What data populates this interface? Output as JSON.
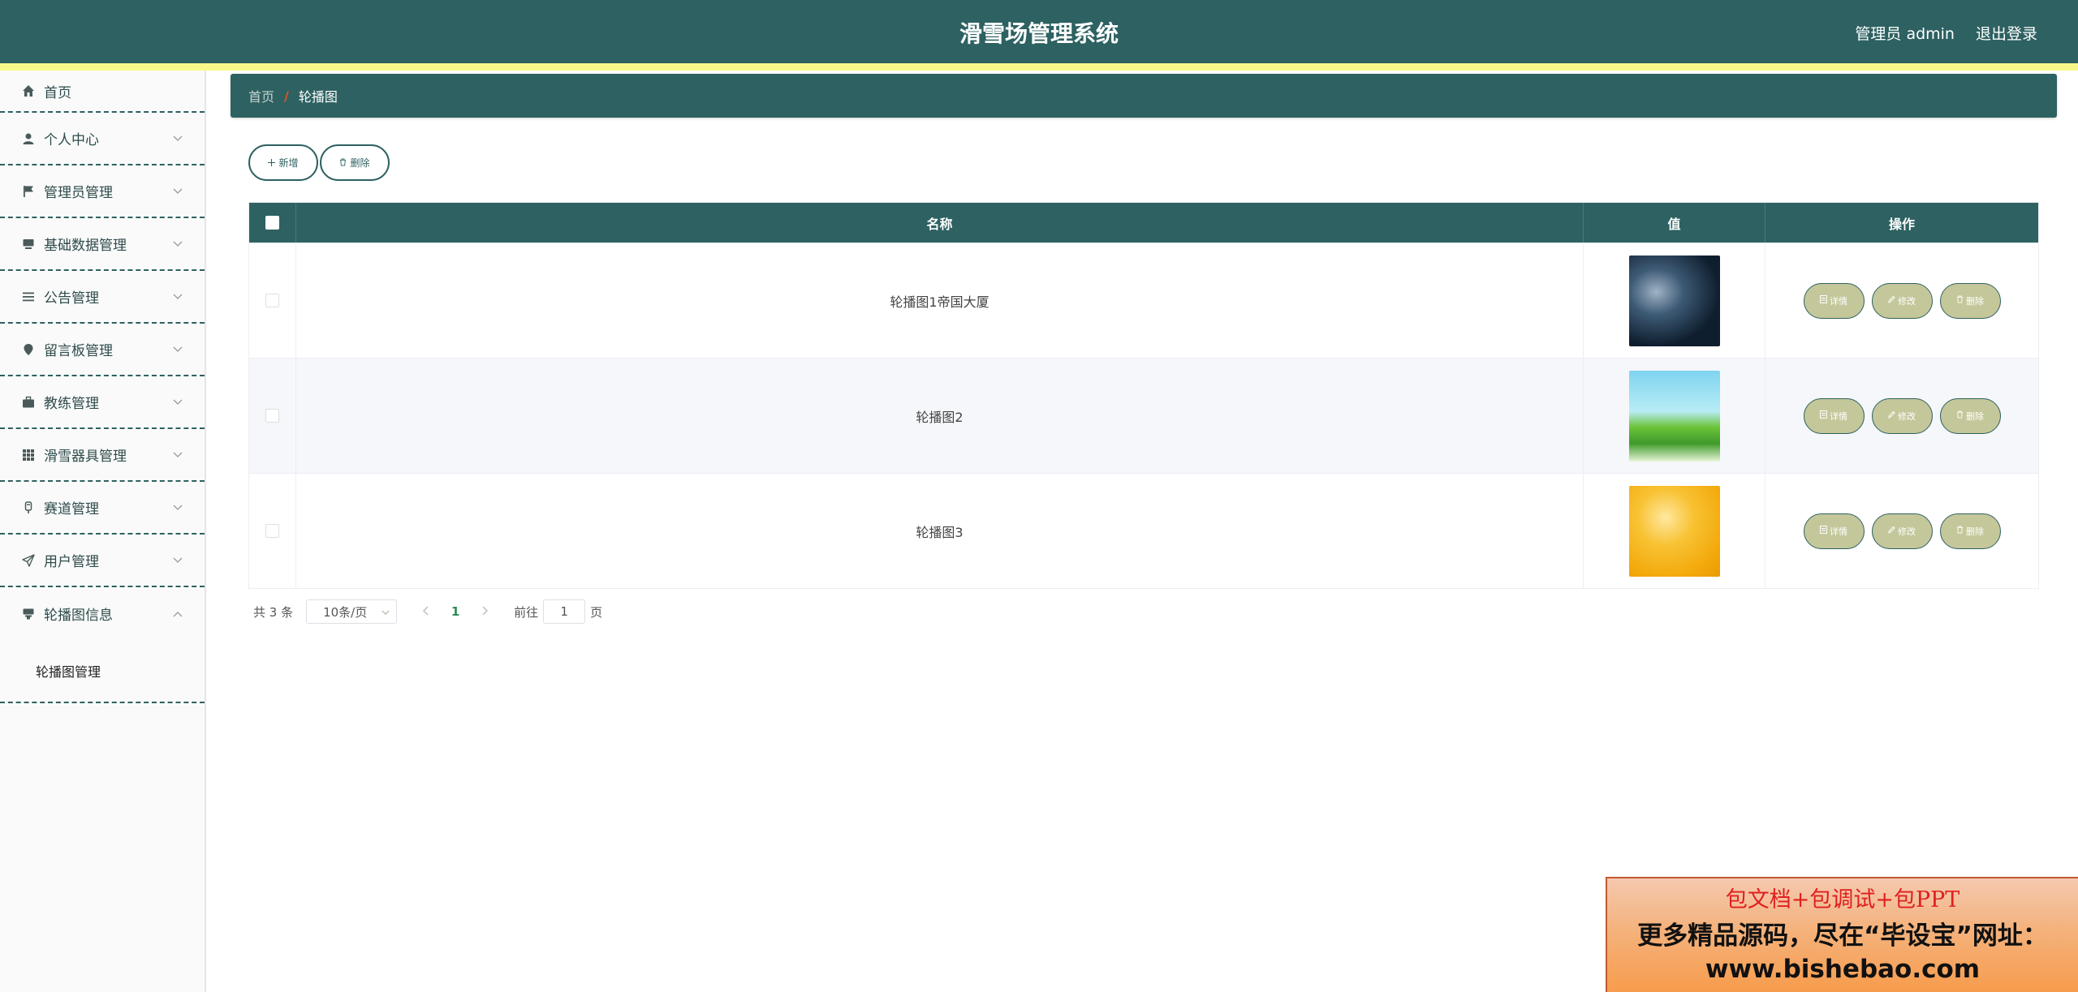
{
  "header": {
    "title": "滑雪场管理系统",
    "user_label": "管理员 admin",
    "logout_label": "退出登录"
  },
  "sidebar": {
    "items": [
      {
        "label": "首页",
        "icon": "home-icon"
      },
      {
        "label": "个人中心",
        "icon": "user-icon"
      },
      {
        "label": "管理员管理",
        "icon": "flag-icon"
      },
      {
        "label": "基础数据管理",
        "icon": "monitor-icon"
      },
      {
        "label": "公告管理",
        "icon": "list-icon"
      },
      {
        "label": "留言板管理",
        "icon": "pin-icon"
      },
      {
        "label": "教练管理",
        "icon": "briefcase-icon"
      },
      {
        "label": "滑雪器具管理",
        "icon": "grid-icon"
      },
      {
        "label": "赛道管理",
        "icon": "track-icon"
      },
      {
        "label": "用户管理",
        "icon": "send-icon"
      },
      {
        "label": "轮播图信息",
        "icon": "banner-icon"
      }
    ],
    "submenu": {
      "label": "轮播图管理"
    }
  },
  "breadcrumb": {
    "home": "首页",
    "separator": "/",
    "current": "轮播图"
  },
  "toolbar": {
    "add_label": "新增",
    "delete_label": "删除"
  },
  "table": {
    "columns": [
      "名称",
      "值",
      "操作"
    ],
    "rows": [
      {
        "name": "轮播图1帝国大厦",
        "thumb": "thumb-1"
      },
      {
        "name": "轮播图2",
        "thumb": "thumb-2"
      },
      {
        "name": "轮播图3",
        "thumb": "thumb-3"
      }
    ],
    "row_actions": {
      "detail": "详情",
      "edit": "修改",
      "delete": "删除"
    }
  },
  "pagination": {
    "total": "共 3 条",
    "page_size": "10条/页",
    "current_page": "1",
    "goto_prefix": "前往",
    "goto_value": "1",
    "goto_suffix": "页"
  },
  "ad": {
    "line1": "包文档+包调试+包PPT",
    "line2": "更多精品源码，尽在“毕设宝”网址：",
    "line3": "www.bishebao.com"
  },
  "colors": {
    "primary": "#2e6161",
    "stripe": "#f8f88a",
    "op_button": "#c4c79a",
    "accent": "#e8502a"
  }
}
